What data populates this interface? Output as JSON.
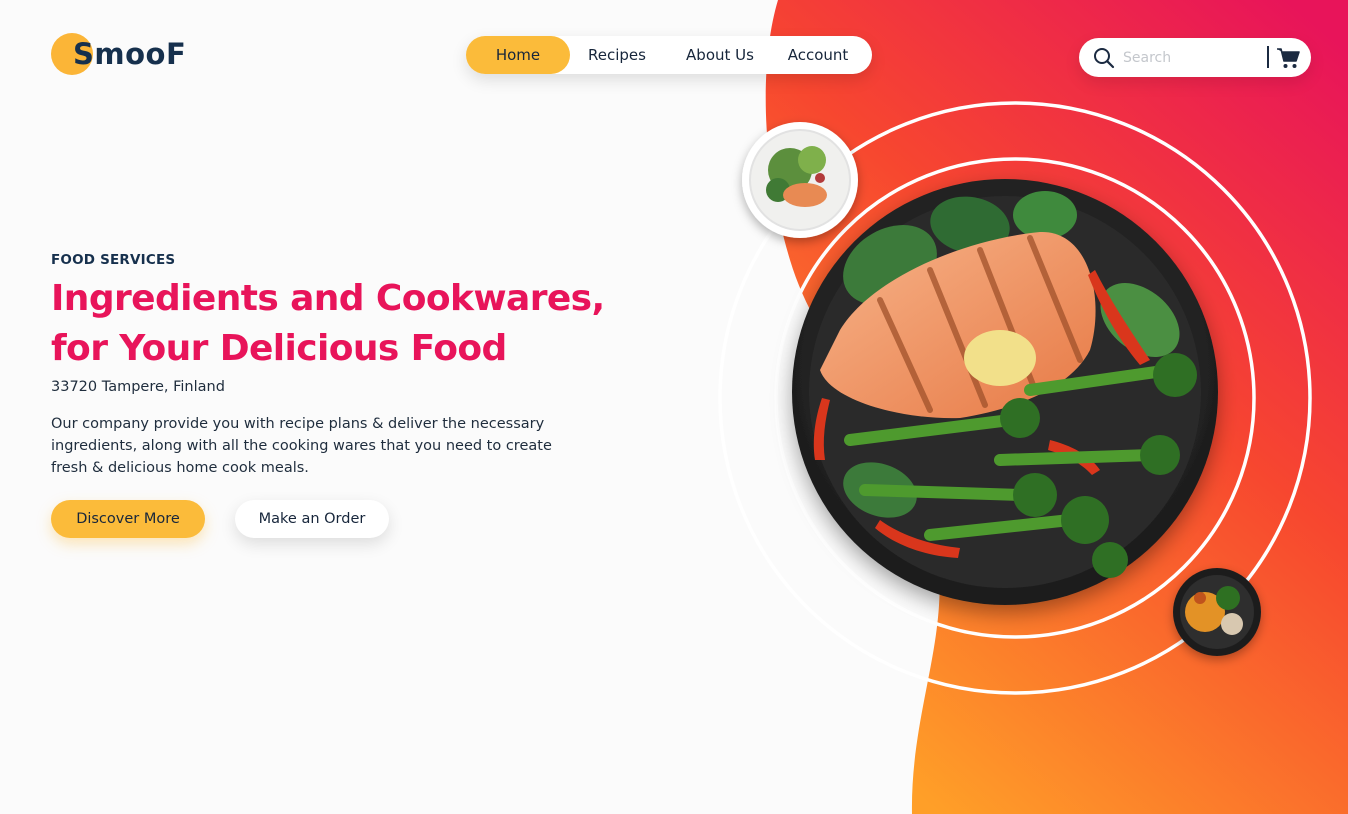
{
  "brand": {
    "name": "SmooF",
    "colors": {
      "accent": "#fbbb3a",
      "headline": "#e8145a",
      "navy": "#16304d",
      "gradient_top": "#e8145a",
      "gradient_bottom": "#ff9a2a"
    }
  },
  "nav": {
    "items": [
      {
        "label": "Home",
        "active": true
      },
      {
        "label": "Recipes",
        "active": false
      },
      {
        "label": "About Us",
        "active": false
      },
      {
        "label": "Account",
        "active": false
      }
    ]
  },
  "search": {
    "placeholder": "Search",
    "value": "",
    "icon": "search-icon",
    "cart_icon": "cart-icon"
  },
  "hero": {
    "eyebrow": "FOOD SERVICES",
    "headline_line1": "Ingredients and Cookwares,",
    "headline_line2": "for Your Delicious Food",
    "location": "33720 Tampere, Finland",
    "description": "Our company provide you with recipe plans & deliver the necessary ingredients, along with all the cooking wares that you need to create fresh & delicious home cook meals.",
    "primary_button": "Discover More",
    "secondary_button": "Make an Order"
  },
  "images": {
    "main_dish": "grilled-salmon-broccolini-plate",
    "small_dish_top": "salmon-salad-bowl",
    "small_dish_bottom": "grain-vegetable-bowl"
  }
}
